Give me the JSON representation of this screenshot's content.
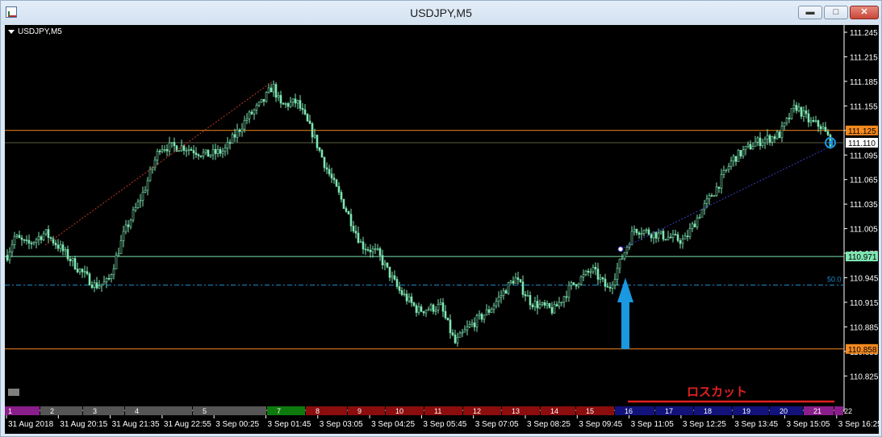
{
  "window": {
    "title": "USDJPY,M5",
    "controls": {
      "minimize": "▬",
      "maximize": "□",
      "close": "✕"
    }
  },
  "chart": {
    "symbol_label": "USDJPY,M5",
    "losscut_label": "ロスカット",
    "fib_label": "50.0",
    "price_axis": [
      "111.245",
      "111.215",
      "111.185",
      "111.155",
      "111.125",
      "111.095",
      "111.065",
      "111.035",
      "111.005",
      "110.975",
      "110.945",
      "110.915",
      "110.885",
      "110.855",
      "110.825"
    ],
    "time_axis": [
      "31 Aug 2018",
      "31 Aug 20:15",
      "31 Aug 21:35",
      "31 Aug 22:55",
      "3 Sep 00:25",
      "3 Sep 01:45",
      "3 Sep 03:05",
      "3 Sep 04:25",
      "3 Sep 05:45",
      "3 Sep 07:05",
      "3 Sep 08:25",
      "3 Sep 09:45",
      "3 Sep 11:05",
      "3 Sep 12:25",
      "3 Sep 13:45",
      "3 Sep 15:05",
      "3 Sep 16:25"
    ],
    "price_tags": [
      {
        "label": "111.125",
        "price": 111.125,
        "color": "#f58a1f"
      },
      {
        "label": "111.110",
        "price": 111.11,
        "color": "#ffffff"
      },
      {
        "label": "110.971",
        "price": 110.971,
        "color": "#7fe6b2"
      },
      {
        "label": "110.858",
        "price": 110.858,
        "color": "#f58a1f"
      }
    ],
    "sessions": [
      {
        "label": "1",
        "color": "#8a1e8a"
      },
      {
        "label": "2",
        "color": "#555555"
      },
      {
        "label": "3",
        "color": "#555555"
      },
      {
        "label": "4",
        "color": "#555555"
      },
      {
        "label": "5",
        "color": "#555555"
      },
      {
        "label": "7",
        "color": "#0e7a0e"
      },
      {
        "label": "8",
        "color": "#8b0d0d"
      },
      {
        "label": "9",
        "color": "#8b0d0d"
      },
      {
        "label": "10",
        "color": "#8b0d0d"
      },
      {
        "label": "11",
        "color": "#8b0d0d"
      },
      {
        "label": "12",
        "color": "#8b0d0d"
      },
      {
        "label": "13",
        "color": "#8b0d0d"
      },
      {
        "label": "14",
        "color": "#8b0d0d"
      },
      {
        "label": "15",
        "color": "#8b0d0d"
      },
      {
        "label": "16",
        "color": "#12127a"
      },
      {
        "label": "17",
        "color": "#12127a"
      },
      {
        "label": "18",
        "color": "#12127a"
      },
      {
        "label": "19",
        "color": "#12127a"
      },
      {
        "label": "20",
        "color": "#12127a"
      },
      {
        "label": "21",
        "color": "#8a1e8a"
      },
      {
        "label": "22",
        "color": "#8a1e8a"
      }
    ],
    "candle_color": "#7fe6b2",
    "fib_line_color": "#1e8fd0",
    "entry_arrow_color": "#1a98e0",
    "losscut_color": "#e0201f"
  }
}
